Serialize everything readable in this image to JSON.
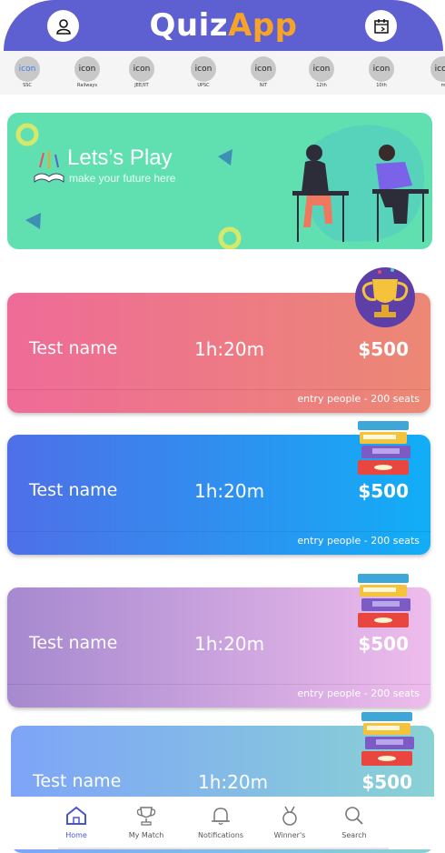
{
  "app": {
    "title_part1": "Quiz",
    "title_part2": "App"
  },
  "categories": [
    {
      "icon_text": "icon",
      "label": "SSC"
    },
    {
      "icon_text": "icon",
      "label": "Railways"
    },
    {
      "icon_text": "icon",
      "label": "JEE/IIT"
    },
    {
      "icon_text": "icon",
      "label": "UPSC"
    },
    {
      "icon_text": "icon",
      "label": "NIT"
    },
    {
      "icon_text": "icon",
      "label": "12th"
    },
    {
      "icon_text": "icon",
      "label": "10th"
    },
    {
      "icon_text": "icon",
      "label": "m"
    }
  ],
  "banner": {
    "title": "Lets’s Play",
    "subtitle": "make your future here"
  },
  "tests": [
    {
      "name": "Test name",
      "duration": "1h:20m",
      "prize": "$500",
      "seats": "entry people - 200 seats"
    },
    {
      "name": "Test name",
      "duration": "1h:20m",
      "prize": "$500",
      "seats": "entry people - 200 seats"
    },
    {
      "name": "Test name",
      "duration": "1h:20m",
      "prize": "$500",
      "seats": "entry people - 200 seats"
    },
    {
      "name": "Test name",
      "duration": "1h:20m",
      "prize": "$500"
    }
  ],
  "nav": [
    {
      "label": "Home",
      "icon": "home-icon"
    },
    {
      "label": "My Match",
      "icon": "trophy-icon"
    },
    {
      "label": "Notifications",
      "icon": "bell-icon"
    },
    {
      "label": "Winner's",
      "icon": "medal-icon"
    },
    {
      "label": "Search",
      "icon": "search-icon"
    }
  ],
  "colors": {
    "header": "#5e5fd0",
    "accent": "#f6a429",
    "banner": "#60e0b1",
    "nav_active": "#4a56d0"
  }
}
